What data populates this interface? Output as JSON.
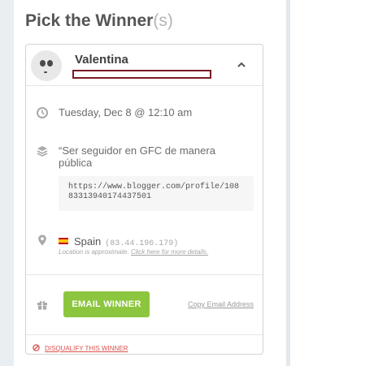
{
  "heading": {
    "main": "Pick the Winner",
    "suffix": "(s)"
  },
  "winner": {
    "name": "Valentina",
    "entry_date": "Tuesday, Dec 8 @ 12:10 am",
    "entry_title": "“Ser seguidor en GFC de manera pública",
    "entry_url": "https://www.blogger.com/profile/10883313940174437501",
    "country": "Spain",
    "ip": "(83.44.196.179)",
    "location_note": "Location is approximate. ",
    "location_link": "Click here for more details."
  },
  "actions": {
    "email_button": "EMAIL WINNER",
    "copy_email": "Copy Email Address",
    "disqualify": "DISQUALIFY THIS WINNER"
  },
  "colors": {
    "accent_green": "#8cc63f",
    "danger_red": "#d9534f",
    "redaction": "#7a1c24"
  },
  "icons": {
    "collapse": "chevron-up-icon",
    "date": "clock-icon",
    "entry": "layers-icon",
    "location": "map-pin-icon",
    "prize": "gift-icon",
    "disqualify": "disqualify-icon"
  }
}
